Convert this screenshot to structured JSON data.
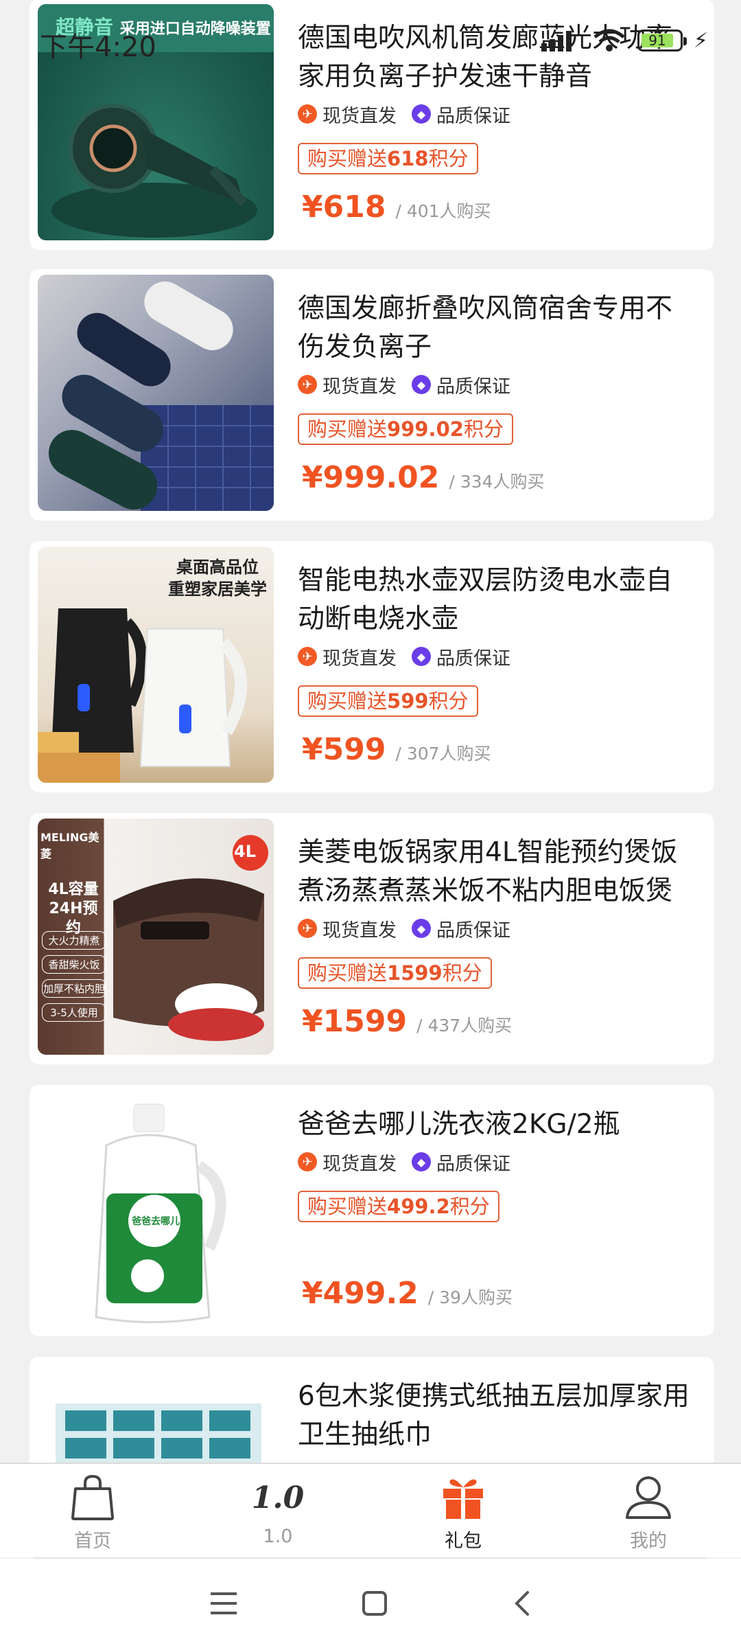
{
  "status_bar": {
    "time": "下午4:20",
    "battery": "91"
  },
  "products": [
    {
      "title": "德国电吹风机筒发廊蓝光大功率家用负离子护发速干静音",
      "tag1": "现货直发",
      "tag2": "品质保证",
      "points_prefix": "购买赠送",
      "points_value": "618",
      "points_suffix": "积分",
      "price": "¥618",
      "sold": "/ 401人购买",
      "image_text": {
        "line1": "超静音",
        "line2": "采用进口自动降噪装置"
      }
    },
    {
      "title": "德国发廊折叠吹风筒宿舍专用不伤发负离子",
      "tag1": "现货直发",
      "tag2": "品质保证",
      "points_prefix": "购买赠送",
      "points_value": "999.02",
      "points_suffix": "积分",
      "price": "¥999.02",
      "sold": "/ 334人购买"
    },
    {
      "title": "智能电热水壶双层防烫电水壶自动断电烧水壶",
      "tag1": "现货直发",
      "tag2": "品质保证",
      "points_prefix": "购买赠送",
      "points_value": "599",
      "points_suffix": "积分",
      "price": "¥599",
      "sold": "/ 307人购买",
      "image_text": {
        "line1": "桌面高品位",
        "line2": "重塑家居美学"
      }
    },
    {
      "title": "美菱电饭锅家用4L智能预约煲饭煮汤蒸煮蒸米饭不粘内胆电饭煲",
      "tag1": "现货直发",
      "tag2": "品质保证",
      "points_prefix": "购买赠送",
      "points_value": "1599",
      "points_suffix": "积分",
      "price": "¥1599",
      "sold": "/ 437人购买",
      "image_text": {
        "brand": "MELING美菱",
        "badge": "4L",
        "line1": "4L容量",
        "line2": "24H预约",
        "features": [
          "大火力精煮",
          "香甜柴火饭",
          "加厚不粘内胆",
          "3-5人使用"
        ]
      }
    },
    {
      "title": "爸爸去哪儿洗衣液2KG/2瓶",
      "tag1": "现货直发",
      "tag2": "品质保证",
      "points_prefix": "购买赠送",
      "points_value": "499.2",
      "points_suffix": "积分",
      "price": "¥499.2",
      "sold": "/ 39人购买",
      "image_text": {
        "label": "爸爸去哪儿"
      }
    },
    {
      "title": "6包木浆便携式纸抽五层加厚家用卫生抽纸巾"
    }
  ],
  "bottom_nav": [
    {
      "label": "首页",
      "icon": "shopping-bag-icon",
      "active": false
    },
    {
      "label": "1.0",
      "icon": "version-logo-icon",
      "active": false
    },
    {
      "label": "礼包",
      "icon": "gift-icon",
      "active": true
    },
    {
      "label": "我的",
      "icon": "user-icon",
      "active": false
    }
  ],
  "colors": {
    "accent": "#f05321",
    "badge_border": "#e2623a",
    "tag_orange": "#f15a24",
    "tag_purple": "#6a3de8"
  },
  "version_logo": "1.0"
}
